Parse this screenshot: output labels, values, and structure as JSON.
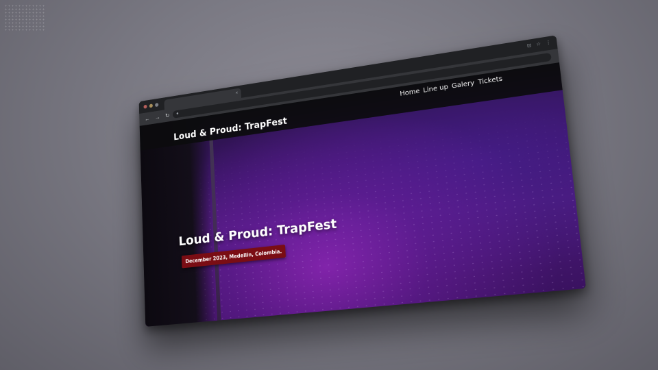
{
  "browser": {
    "tab": {
      "close_glyph": "×"
    },
    "icons": [
      "back-icon",
      "forward-icon",
      "reload-icon",
      "lock-icon",
      "extension-icon",
      "star-icon",
      "menu-icon"
    ]
  },
  "site": {
    "title": "Loud & Proud: TrapFest",
    "nav": [
      "Home",
      "Line up",
      "Galery",
      "Tickets"
    ]
  },
  "hero": {
    "title": "Loud & Proud: TrapFest",
    "subtitle": "December 2023, Medellin, Colombia."
  },
  "colors": {
    "badge": "#7a0d14",
    "hero_purple": "#4b1a7a",
    "header_bg": "#0c0c0e"
  }
}
